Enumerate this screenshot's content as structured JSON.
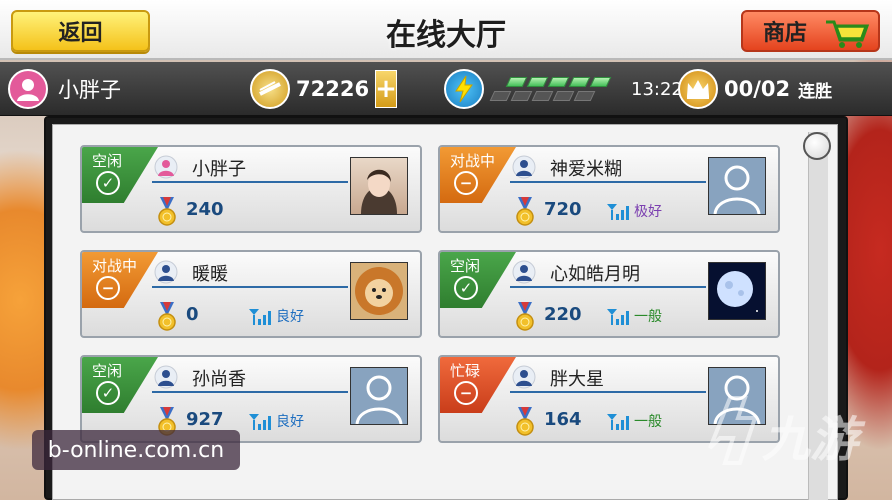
{
  "header": {
    "back_label": "返回",
    "title": "在线大厅",
    "shop_label": "商店"
  },
  "status": {
    "username": "小胖子",
    "coins": "72226",
    "plus": "+",
    "time": "13:22",
    "streak": "00/02",
    "streak_label": "连胜"
  },
  "players": [
    {
      "status": "空闲",
      "status_icon": "check-icon",
      "name": "小胖子",
      "gender": "female",
      "score": "240",
      "signal": "",
      "avatar": "photo-girl"
    },
    {
      "status": "对战中",
      "status_icon": "minus-icon",
      "name": "神爱米糊",
      "gender": "male",
      "score": "720",
      "signal": "极好",
      "avatar": "default"
    },
    {
      "status": "对战中",
      "status_icon": "minus-icon",
      "name": "暖暖",
      "gender": "male",
      "score": "0",
      "signal": "良好",
      "avatar": "photo-lion-dog"
    },
    {
      "status": "空闲",
      "status_icon": "check-icon",
      "name": "心如皓月明",
      "gender": "male",
      "score": "220",
      "signal": "一般",
      "avatar": "photo-moon"
    },
    {
      "status": "空闲",
      "status_icon": "check-icon",
      "name": "孙尚香",
      "gender": "male",
      "score": "927",
      "signal": "良好",
      "avatar": "default"
    },
    {
      "status": "忙碌",
      "status_icon": "minus-icon",
      "name": "胖大星",
      "gender": "male",
      "score": "164",
      "signal": "一般",
      "avatar": "default"
    }
  ],
  "watermark": "b-online.com.cn",
  "watermark_logo_text": "九游",
  "colors": {
    "idle": "#3c963c",
    "fighting": "#e98323",
    "busy": "#e05a30",
    "score": "#1a4a7e"
  }
}
